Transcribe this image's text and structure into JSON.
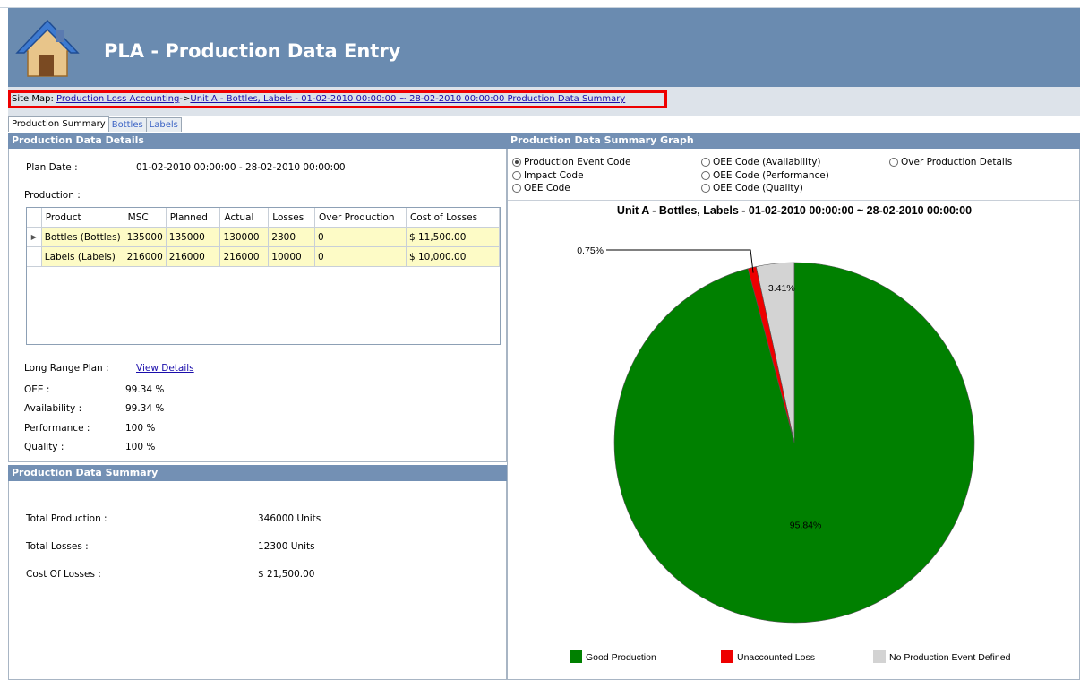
{
  "app": {
    "title": "PLA - Production Data Entry"
  },
  "sitemap": {
    "prefix": "Site Map: ",
    "link1": "Production Loss Accounting",
    "separator": "->",
    "link2": "Unit A - Bottles, Labels - 01-02-2010 00:00:00 ~ 28-02-2010 00:00:00 Production Data Summary"
  },
  "tabs": [
    "Production Summary",
    "Bottles",
    "Labels"
  ],
  "details": {
    "header": "Production Data Details",
    "plan_date_label": "Plan Date :",
    "plan_date_value": "01-02-2010 00:00:00 - 28-02-2010 00:00:00",
    "production_label": "Production :",
    "columns": [
      "Product",
      "MSC",
      "Planned",
      "Actual",
      "Losses",
      "Over Production",
      "Cost of Losses"
    ],
    "rows": [
      [
        "Bottles (Bottles)",
        "135000",
        "135000",
        "130000",
        "2300",
        "0",
        "$ 11,500.00"
      ],
      [
        "Labels (Labels)",
        "216000",
        "216000",
        "216000",
        "10000",
        "0",
        "$ 10,000.00"
      ]
    ],
    "long_range_label": "Long Range Plan :",
    "long_range_link": "View Details",
    "oee_label": "OEE :",
    "oee_value": "99.34 %",
    "availability_label": "Availability :",
    "availability_value": "99.34 %",
    "performance_label": "Performance :",
    "performance_value": "100 %",
    "quality_label": "Quality :",
    "quality_value": "100 %"
  },
  "summary": {
    "header": "Production Data Summary",
    "total_production_label": "Total Production :",
    "total_production_value": "346000 Units",
    "total_losses_label": "Total Losses :",
    "total_losses_value": "12300 Units",
    "cost_label": "Cost Of Losses :",
    "cost_value": "$ 21,500.00"
  },
  "graph": {
    "header": "Production Data Summary Graph",
    "options": [
      {
        "label": "Production Event Code",
        "selected": true
      },
      {
        "label": "Impact Code",
        "selected": false
      },
      {
        "label": "OEE Code",
        "selected": false
      },
      {
        "label": "OEE Code (Availability)",
        "selected": false
      },
      {
        "label": "OEE Code (Performance)",
        "selected": false
      },
      {
        "label": "OEE Code (Quality)",
        "selected": false
      },
      {
        "label": "Over Production Details",
        "selected": false
      }
    ]
  },
  "chart_data": {
    "type": "pie",
    "title": "Unit A - Bottles, Labels - 01-02-2010 00:00:00 ~ 28-02-2010 00:00:00",
    "slices": [
      {
        "name": "No Production Event Defined",
        "value": 3.41,
        "label": "3.41%",
        "color": "#d3d3d3"
      },
      {
        "name": "Unaccounted Loss",
        "value": 0.75,
        "label": "0.75%",
        "color": "#ee0000"
      },
      {
        "name": "Good Production",
        "value": 95.84,
        "label": "95.84%",
        "color": "#008000"
      }
    ],
    "legend": [
      "Good Production",
      "Unaccounted Loss",
      "No Production Event Defined"
    ],
    "legend_position": "bottom"
  }
}
